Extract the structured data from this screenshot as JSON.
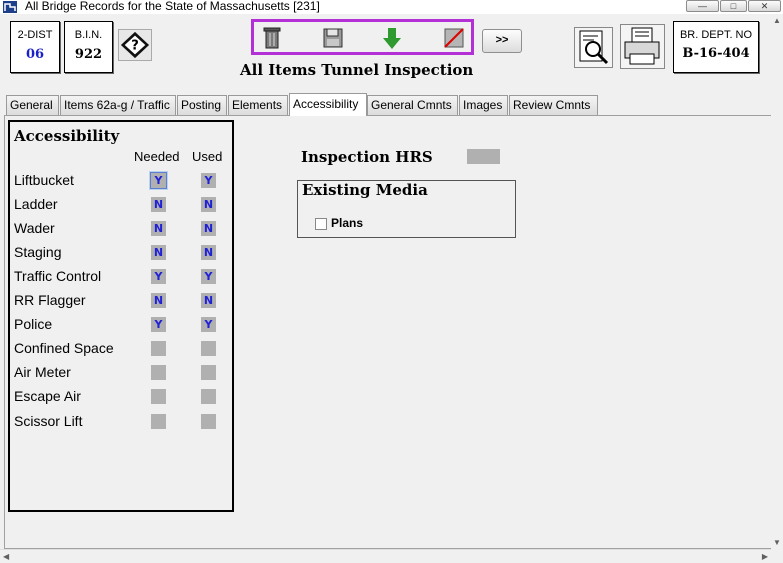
{
  "window": {
    "title": "All Bridge Records for the State of Massachusetts [231]"
  },
  "header": {
    "dist_label": "2-DIST",
    "dist_value": "06",
    "bin_label": "B.I.N.",
    "bin_value": "922",
    "deptno_label": "BR. DEPT. NO",
    "deptno_value": "B-16-404",
    "next_label": ">>",
    "form_title": "All Items Tunnel Inspection"
  },
  "tabs": [
    {
      "label": "General"
    },
    {
      "label": "Items 62a-g / Traffic"
    },
    {
      "label": "Posting"
    },
    {
      "label": "Elements"
    },
    {
      "label": "Accessibility"
    },
    {
      "label": "General Cmnts"
    },
    {
      "label": "Images"
    },
    {
      "label": "Review Cmnts"
    }
  ],
  "active_tab": "Accessibility",
  "accessibility": {
    "title": "Accessibility",
    "col_needed": "Needed",
    "col_used": "Used",
    "rows": [
      {
        "label": "Liftbucket",
        "needed": "Y",
        "used": "Y"
      },
      {
        "label": "Ladder",
        "needed": "N",
        "used": "N"
      },
      {
        "label": "Wader",
        "needed": "N",
        "used": "N"
      },
      {
        "label": "Staging",
        "needed": "N",
        "used": "N"
      },
      {
        "label": "Traffic Control",
        "needed": "Y",
        "used": "Y"
      },
      {
        "label": "RR Flagger",
        "needed": "N",
        "used": "N"
      },
      {
        "label": "Police",
        "needed": "Y",
        "used": "Y"
      },
      {
        "label": "Confined Space",
        "needed": "",
        "used": ""
      },
      {
        "label": "Air Meter",
        "needed": "",
        "used": ""
      },
      {
        "label": "Escape Air",
        "needed": "",
        "used": ""
      },
      {
        "label": "Scissor Lift",
        "needed": "",
        "used": ""
      }
    ]
  },
  "inspection_hrs": {
    "label": "Inspection HRS",
    "value": ""
  },
  "existing_media": {
    "title": "Existing Media",
    "plans_label": "Plans",
    "plans_checked": false
  },
  "colors": {
    "toolbar_border": "#b32fd6",
    "yn_text": "#2020d6",
    "dist_value": "#1a22c8"
  },
  "icons": [
    "app-icon",
    "help-icon",
    "delete-icon",
    "save-icon",
    "download-icon",
    "cancel-icon",
    "print-preview-icon",
    "print-icon"
  ]
}
